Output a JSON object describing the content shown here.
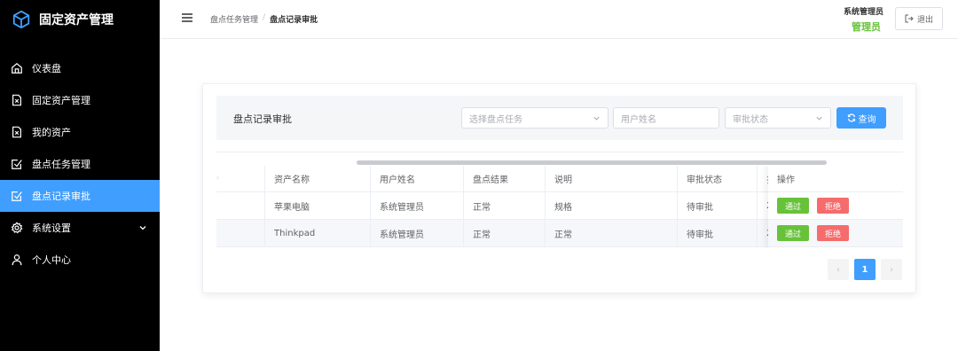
{
  "app": {
    "title": "固定资产管理"
  },
  "sidebar": {
    "items": [
      {
        "label": "仪表盘",
        "icon": "home-icon"
      },
      {
        "label": "固定资产管理",
        "icon": "document-icon"
      },
      {
        "label": "我的资产",
        "icon": "document-icon"
      },
      {
        "label": "盘点任务管理",
        "icon": "checkbox-icon"
      },
      {
        "label": "盘点记录审批",
        "icon": "checkbox-icon",
        "active": true
      },
      {
        "label": "系统设置",
        "icon": "gear-icon",
        "expandable": true
      },
      {
        "label": "个人中心",
        "icon": "user-icon"
      }
    ]
  },
  "header": {
    "breadcrumb": {
      "parent": "盘点任务管理",
      "separator": "/",
      "current": "盘点记录审批"
    },
    "user_role": "系统管理员",
    "user_name": "管理员",
    "logout_label": "退出"
  },
  "filter": {
    "title": "盘点记录审批",
    "task_placeholder": "选择盘点任务",
    "user_placeholder": "用户姓名",
    "status_placeholder": "审批状态",
    "search_label": "查询"
  },
  "table": {
    "columns": [
      "资产名称",
      "用户姓名",
      "盘点结果",
      "说明",
      "审批状态",
      "操作"
    ],
    "rows": [
      {
        "asset": "苹果电脑",
        "user": "系统管理员",
        "result": "正常",
        "note": "规格",
        "status": "待审批",
        "clipped": "2"
      },
      {
        "asset": "Thinkpad",
        "user": "系统管理员",
        "result": "正常",
        "note": "正常",
        "status": "待审批",
        "clipped": "2"
      }
    ],
    "pass_label": "通过",
    "reject_label": "拒绝"
  },
  "pagination": {
    "prev": "‹",
    "current_page": "1",
    "next": "›"
  },
  "colors": {
    "accent": "#409eff",
    "success": "#67c23a",
    "danger": "#f56c6c",
    "sidebar_bg": "#000000"
  }
}
